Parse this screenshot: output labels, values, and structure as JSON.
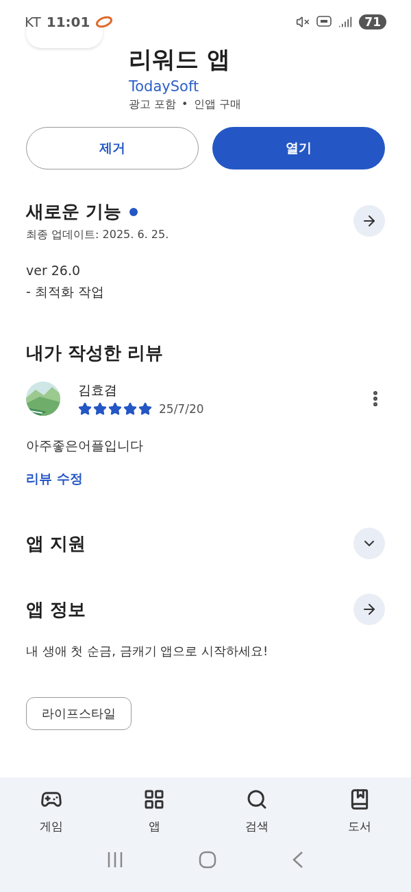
{
  "status_bar": {
    "carrier": "KT",
    "time": "11:01",
    "battery": "71"
  },
  "app": {
    "title": "리워드 앱",
    "developer": "TodaySoft",
    "info": "광고 포함",
    "separator": "•",
    "info_2": "인앱 구매"
  },
  "buttons": [
    {
      "label": "제거",
      "kind": "outline"
    },
    {
      "label": "열기",
      "kind": "filled"
    }
  ],
  "whats_new": {
    "title": "새로운 기능",
    "new_dot": true,
    "updated": "최종 업데이트: 2025. 6. 25.",
    "lines": [
      "ver 26.0",
      "- 최적화 작업"
    ]
  },
  "my_review": {
    "title": "내가 작성한 리뷰",
    "author": "김효겸",
    "stars": 5,
    "date": "25/7/20",
    "text": "아주좋은어플입니다",
    "edit_link": "리뷰 수정"
  },
  "sections": [
    {
      "title": "앱 지원",
      "kind": "expand",
      "expanded": false
    },
    {
      "title": "앱 정보",
      "kind": "link",
      "description": "내 생애 첫 순금, 금캐기 앱으로 시작하세요!",
      "tag": "라이프스타일"
    }
  ],
  "bottom_nav": [
    {
      "label": "게임",
      "selected": false
    },
    {
      "label": "앱",
      "selected": false
    },
    {
      "label": "검색",
      "selected": false
    },
    {
      "label": "도서",
      "selected": false
    }
  ]
}
